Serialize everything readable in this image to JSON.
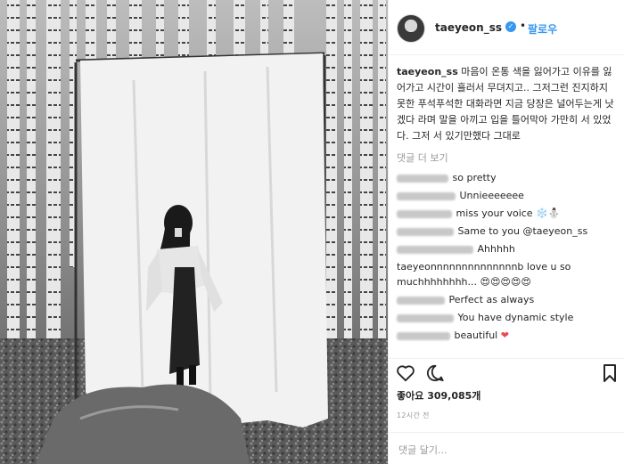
{
  "header": {
    "username": "taeyeon_ss",
    "separator": "•",
    "follow_label": "팔로우"
  },
  "caption": {
    "username": "taeyeon_ss",
    "text": "마음이 온통 색을 잃어가고 이유를 잃어가고 시간이 흘러서 무뎌지고.. 그저그런 진지하지 못한 푸석푸석한 대화라면 지금 당장은 널어두는게 낫겠다 라며 말을 아끼고 입을 틀어막아 가만히 서 있었다. 그저 서 있기만했다 그대로"
  },
  "view_more_label": "댓글 더 보기",
  "comments": [
    {
      "text": "so pretty",
      "suffix": ""
    },
    {
      "text": "Unnieeeeeee",
      "suffix": ""
    },
    {
      "text": "miss your voice",
      "suffix": "❄️⛄"
    },
    {
      "text": "Same to you @taeyeon_ss",
      "suffix": ""
    },
    {
      "text": "Ahhhhh",
      "suffix": ""
    },
    {
      "text": "taeyeonnnnnnnnnnnnnnb love u so muchhhhhhhh...",
      "suffix": "😍😍😍😍😍"
    },
    {
      "text": "Perfect as always",
      "suffix": ""
    },
    {
      "text": "You have dynamic style",
      "suffix": ""
    },
    {
      "text": "beautiful",
      "suffix": "❤"
    }
  ],
  "icons": {
    "like": "heart-icon",
    "comment": "comment-icon",
    "save": "bookmark-icon",
    "verified": "verified-badge-icon"
  },
  "likes_label": "좋아요 309,085개",
  "timestamp": "12시간 전",
  "add_comment_placeholder": "댓글 달기...",
  "colors": {
    "link": "#3897f0",
    "verified": "#3897f0",
    "text": "#262626",
    "muted": "#999999",
    "heart": "#ed4956"
  }
}
